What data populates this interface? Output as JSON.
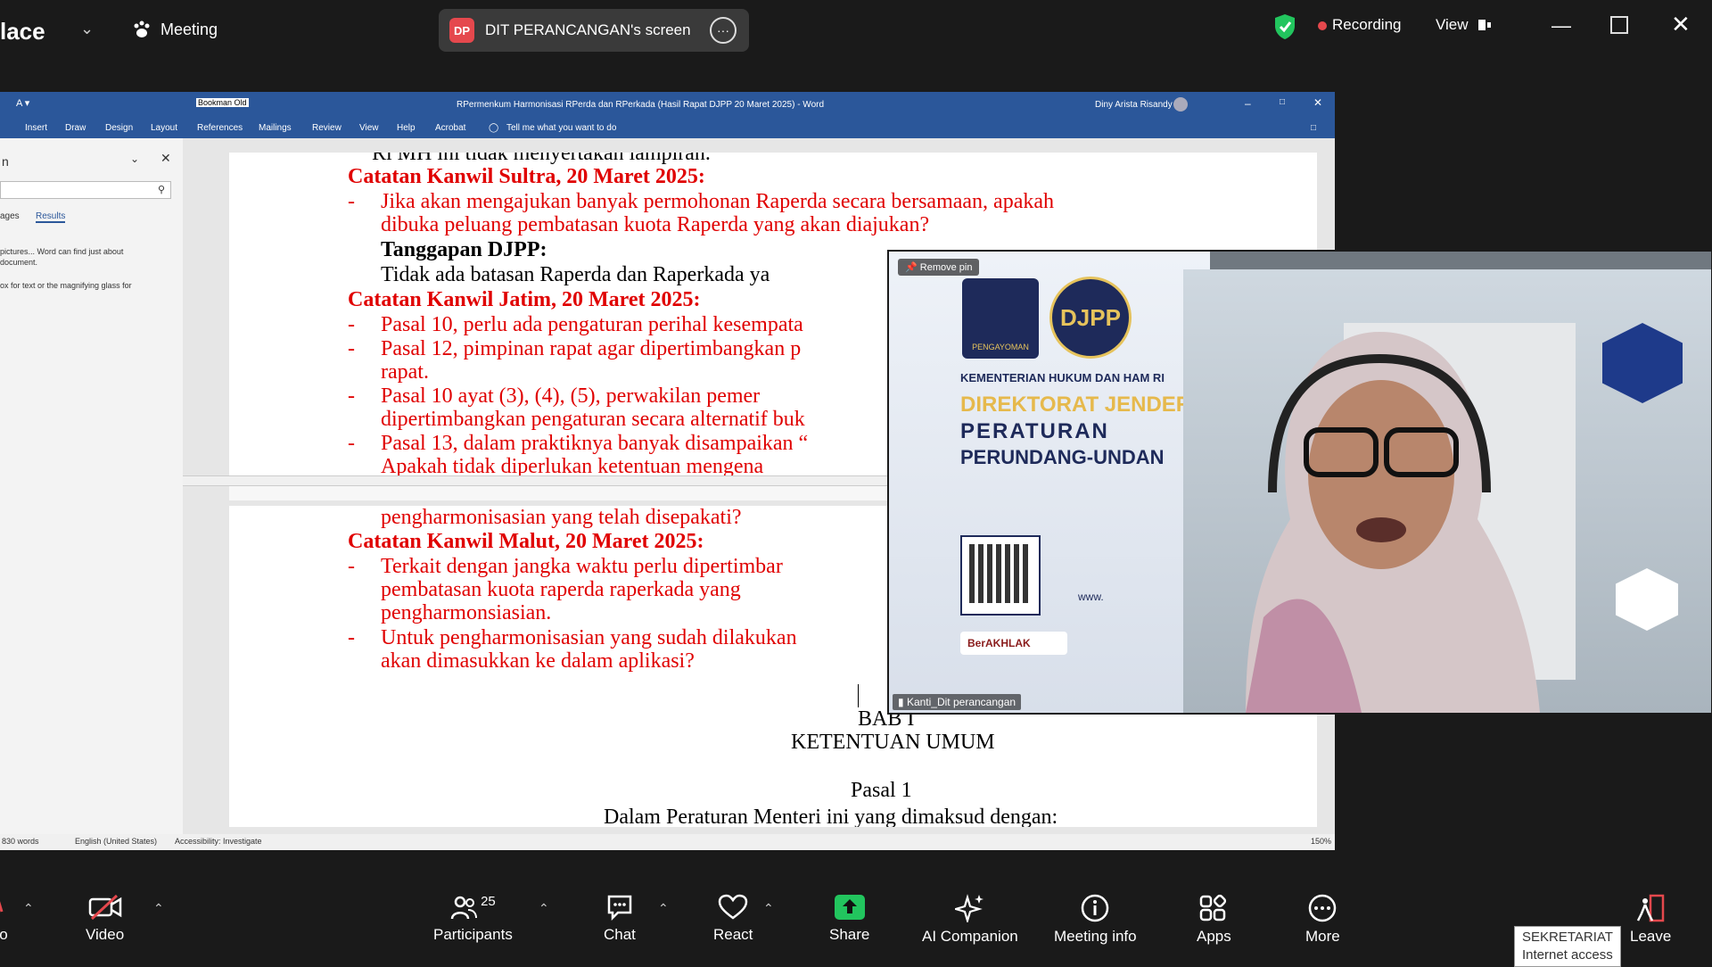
{
  "topbar": {
    "title": "lace",
    "meeting_label": "Meeting",
    "share_badge": "DP",
    "share_label": "DIT PERANCANGAN's screen",
    "recording_label": "Recording",
    "view_label": "View",
    "colors": {
      "recording": "#e5484d",
      "shield": "#22c55e"
    }
  },
  "word": {
    "title": "RPermenkum Harmonisasi RPerda dan RPerkada (Hasil Rapat DJPP 20 Maret 2025) - Word",
    "user": "Diny Arista Risandy",
    "font_box": "Bookman Old",
    "ribbon_tabs": [
      "Insert",
      "Draw",
      "Design",
      "Layout",
      "References",
      "Mailings",
      "Review",
      "View",
      "Help",
      "Acrobat"
    ],
    "tell_me": "Tell me what you want to do",
    "nav": {
      "title": "n",
      "tab_pages": "ages",
      "tab_results": "Results",
      "hint1": "pictures... Word can find just about",
      "hint2": "document.",
      "hint3": "ox for text or the magnifying glass for"
    },
    "status": {
      "words": "830 words",
      "language": "English (United States)",
      "accessibility": "Accessibility: Investigate",
      "zoom": "150%"
    }
  },
  "doc": {
    "p1_top": "Ri MH ini tidak menyertakan lampiran.",
    "sultra_head": "Catatan Kanwil Sultra, 20 Maret 2025:",
    "sultra_1a": "Jika  akan  mengajukan  banyak  permohonan  Raperda  secara  bersamaan,  apakah",
    "sultra_1b": "dibuka peluang pembatasan kuota Raperda yang akan diajukan?",
    "tanggapan_head": "Tanggapan DJPP:",
    "tanggapan_1": "Tidak ada batasan Raperda dan Raperkada ya",
    "jatim_head": "Catatan Kanwil Jatim, 20 Maret 2025:",
    "jatim_1": "Pasal 10, perlu ada pengaturan perihal kesempata",
    "jatim_2a": "Pasal 12, pimpinan rapat agar dipertimbangkan p",
    "jatim_2b": "rapat.",
    "jatim_3a": "Pasal  10  ayat  (3),  (4),  (5),  perwakilan  pemer",
    "jatim_3b": "dipertimbangkan pengaturan secara alternatif buk",
    "jatim_4a": "Pasal 13, dalam praktiknya banyak disampaikan “",
    "jatim_4b": "Apakah  tidak  diperlukan  ketentuan  mengena",
    "p2_top": "pengharmonisasian yang telah disepakati?",
    "malut_head": "Catatan Kanwil Malut, 20 Maret 2025:",
    "malut_1a": "Terkait  dengan  jangka  waktu  perlu  dipertimbar",
    "malut_1b": "pembatasan   kuota   raperda   raperkada   yang",
    "malut_1c": "pengharmonsiasian.",
    "malut_2a": "Untuk pengharmonisasian yang sudah dilakukan",
    "malut_2b": "akan dimasukkan ke dalam aplikasi?",
    "bab": "BAB I",
    "ketentuan": "KETENTUAN UMUM",
    "pasal": "Pasal 1",
    "pasal_next": "Dalam Peraturan Menteri ini yang dimaksud dengan:",
    "dash": "-"
  },
  "video": {
    "remove_pin": "Remove pin",
    "name": "Kanti_Dit perancangan",
    "logo1": "PENGAYOMAN",
    "logo2": "DJPP",
    "org1": "KEMENTERIAN HUKUM DAN HAM RI",
    "org2": "DIREKTORAT JENDER",
    "org3": "PERATURAN",
    "org4": "PERUNDANG-UNDAN",
    "web": "www.",
    "berakhlak": "BerAKHLAK"
  },
  "toolbar": {
    "audio_label": "o",
    "video_label": "Video",
    "participants_label": "Participants",
    "participants_count": "25",
    "chat_label": "Chat",
    "react_label": "React",
    "share_label": "Share",
    "ai_label": "AI Companion",
    "info_label": "Meeting info",
    "apps_label": "Apps",
    "more_label": "More",
    "leave_label": "Leave",
    "share_color": "#22c55e"
  },
  "tooltip": {
    "line1": "SEKRETARIAT",
    "line2": "Internet access"
  }
}
